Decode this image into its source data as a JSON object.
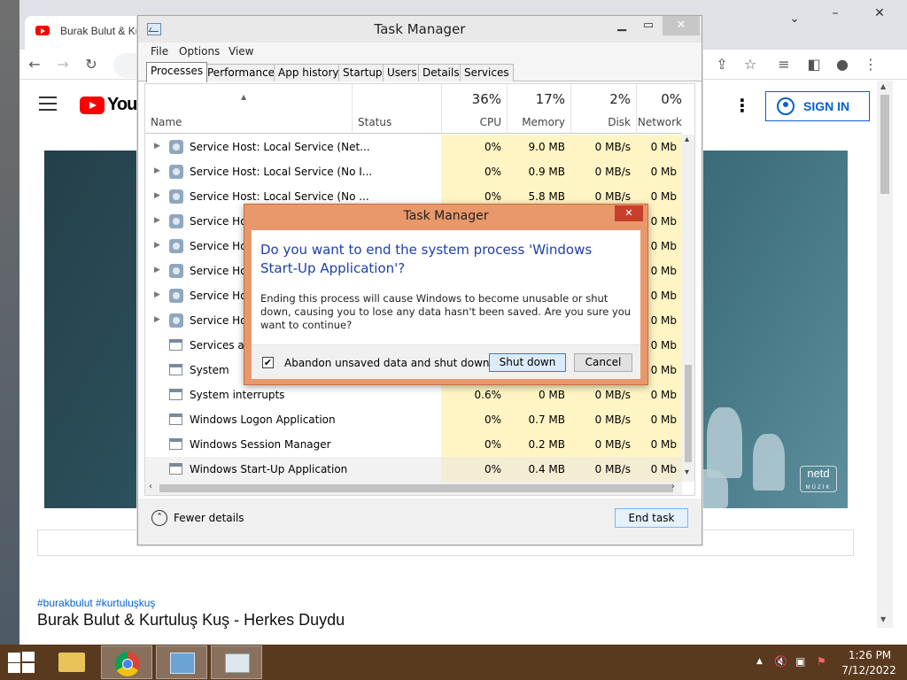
{
  "browser": {
    "tab_title": "Burak Bulut & Kurtuluş",
    "youtube_logo_text": "YouTube",
    "sign_in": "SIGN IN",
    "hashtags": "#burakbulut #kurtuluşkuş",
    "video_title": "Burak Bulut & Kurtuluş Kuş - Herkes Duydu",
    "watermark": "netd",
    "watermark_sub": "MÜZİK"
  },
  "task_manager": {
    "title": "Task Manager",
    "menu": [
      "File",
      "Options",
      "View"
    ],
    "tabs": [
      "Processes",
      "Performance",
      "App history",
      "Startup",
      "Users",
      "Details",
      "Services"
    ],
    "active_tab": "Processes",
    "columns": {
      "name": "Name",
      "status": "Status",
      "cpu": {
        "percent": "36%",
        "label": "CPU"
      },
      "memory": {
        "percent": "17%",
        "label": "Memory"
      },
      "disk": {
        "percent": "2%",
        "label": "Disk"
      },
      "network": {
        "percent": "0%",
        "label": "Network"
      }
    },
    "rows": [
      {
        "name": "Service Host: Local Service (Net...",
        "icon": "gear-icon",
        "expandable": true,
        "cpu": "0%",
        "memory": "9.0 MB",
        "disk": "0 MB/s",
        "network": "0 Mb"
      },
      {
        "name": "Service Host: Local Service (No I...",
        "icon": "gear-icon",
        "expandable": true,
        "cpu": "0%",
        "memory": "0.9 MB",
        "disk": "0 MB/s",
        "network": "0 Mb"
      },
      {
        "name": "Service Host: Local Service (No ...",
        "icon": "gear-icon",
        "expandable": true,
        "cpu": "0%",
        "memory": "5.8 MB",
        "disk": "0 MB/s",
        "network": "0 Mb"
      },
      {
        "name": "Service Host",
        "icon": "gear-icon",
        "expandable": true,
        "cpu": "",
        "memory": "",
        "disk": "",
        "network": "0 Mb"
      },
      {
        "name": "Service Host",
        "icon": "gear-icon",
        "expandable": true,
        "cpu": "",
        "memory": "",
        "disk": "",
        "network": "0 Mb"
      },
      {
        "name": "Service Host",
        "icon": "gear-icon",
        "expandable": true,
        "cpu": "",
        "memory": "",
        "disk": "",
        "network": "0 Mb"
      },
      {
        "name": "Service Host",
        "icon": "gear-icon",
        "expandable": true,
        "cpu": "",
        "memory": "",
        "disk": "",
        "network": "0 Mb"
      },
      {
        "name": "Service Host",
        "icon": "gear-icon",
        "expandable": true,
        "cpu": "",
        "memory": "",
        "disk": "",
        "network": "0 Mb"
      },
      {
        "name": "Services and",
        "icon": "window-icon",
        "expandable": false,
        "cpu": "",
        "memory": "",
        "disk": "",
        "network": "0 Mb"
      },
      {
        "name": "System",
        "icon": "window-icon",
        "expandable": false,
        "cpu": "",
        "memory": "",
        "disk": "",
        "network": "0 Mb"
      },
      {
        "name": "System interrupts",
        "icon": "window-icon",
        "expandable": false,
        "cpu": "0.6%",
        "memory": "0 MB",
        "disk": "0 MB/s",
        "network": "0 Mb"
      },
      {
        "name": "Windows Logon Application",
        "icon": "window-icon",
        "expandable": false,
        "cpu": "0%",
        "memory": "0.7 MB",
        "disk": "0 MB/s",
        "network": "0 Mb"
      },
      {
        "name": "Windows Session Manager",
        "icon": "window-icon",
        "expandable": false,
        "cpu": "0%",
        "memory": "0.2 MB",
        "disk": "0 MB/s",
        "network": "0 Mb"
      },
      {
        "name": "Windows Start-Up Application",
        "icon": "window-icon",
        "expandable": false,
        "selected": true,
        "cpu": "0%",
        "memory": "0.4 MB",
        "disk": "0 MB/s",
        "network": "0 Mb"
      }
    ],
    "fewer_details": "Fewer details",
    "end_task": "End task"
  },
  "dialog": {
    "title": "Task Manager",
    "heading": "Do you want to end the system process 'Windows Start-Up Application'?",
    "message": "Ending this process will cause Windows to become unusable or shut down, causing you to lose any data hasn't been saved. Are you sure you want to continue?",
    "checkbox_label": "Abandon unsaved data and shut down.",
    "checkbox_checked": true,
    "shutdown_button": "Shut down",
    "cancel_button": "Cancel"
  },
  "taskbar": {
    "time": "1:26 PM",
    "date": "7/12/2022"
  }
}
